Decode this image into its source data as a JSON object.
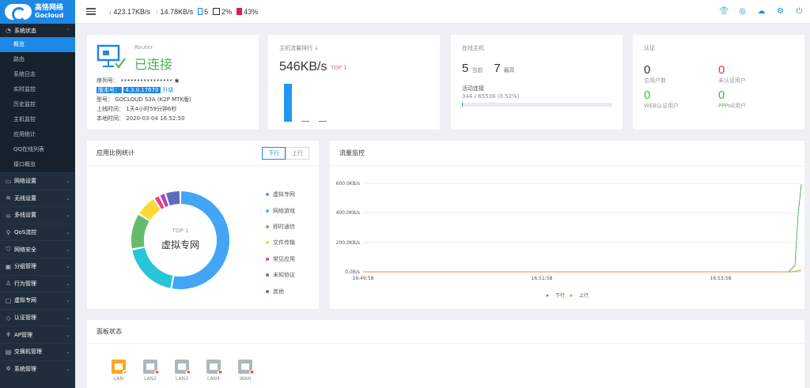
{
  "brand": {
    "name_cn": "高恪网络",
    "name_en": "Gocloud"
  },
  "topbar": {
    "down_speed": "423.17KB/s",
    "up_speed": "14.78KB/s",
    "mem": "5",
    "cpu": "2%",
    "disk": "43%",
    "icons": [
      "shirt-icon",
      "globe-icon",
      "cloud-upload-icon",
      "gear-icon",
      "power-icon"
    ]
  },
  "sidebar": {
    "status_group": "系统状态",
    "status_items": [
      "概览",
      "路由",
      "系统日志",
      "实时监控",
      "历史监控",
      "主机监控",
      "应用统计",
      "QQ在线列表",
      "接口概览"
    ],
    "groups": [
      {
        "label": "网络设置",
        "icon": "monitor-icon"
      },
      {
        "label": "无线设置",
        "icon": "wifi-icon"
      },
      {
        "label": "多线设置",
        "icon": "sliders-icon"
      },
      {
        "label": "QoS流控",
        "icon": "pin-icon"
      },
      {
        "label": "网络安全",
        "icon": "shield-icon"
      },
      {
        "label": "分组管理",
        "icon": "folder-icon"
      },
      {
        "label": "行为管理",
        "icon": "user-icon"
      },
      {
        "label": "虚拟专网",
        "icon": "lock-icon"
      },
      {
        "label": "认证管理",
        "icon": "badge-icon"
      },
      {
        "label": "AP管理",
        "icon": "antenna-icon"
      },
      {
        "label": "交换机管理",
        "icon": "switch-icon"
      },
      {
        "label": "系统管理",
        "icon": "cog-icon"
      }
    ]
  },
  "router_card": {
    "label": "Router",
    "status": "已连接",
    "serial_label": "序列号：",
    "serial_value": "••••••••••••••••",
    "version_label": "版本号：",
    "version_value": "4.3.0.17670",
    "upgrade": "升级",
    "model_label": "型号：",
    "model_value": "GOCLOUD S3A (K2P MTK版)",
    "uptime_label": "上线时间：",
    "uptime_value": "1天4小时59分钟6秒",
    "localtime_label": "本地时间：",
    "localtime_value": "2020-03-04 16:52:50"
  },
  "traffic_rank": {
    "title": "主机流量排行 ↓",
    "speed": "546KB/s",
    "top": "TOP 1",
    "bars": [
      1.0,
      0.03,
      0.02
    ]
  },
  "online_hosts": {
    "title": "在线主机",
    "current": "5",
    "current_label": "当前",
    "peak": "7",
    "peak_label": "最高",
    "conn_label": "活动连接",
    "conn_value": "344 / 65536 (0.52%)",
    "conn_fraction": 0.0052
  },
  "auth": {
    "title": "认证",
    "total_users": "0",
    "total_users_label": "总用户数",
    "unauth_users": "0",
    "unauth_users_label": "未认证用户",
    "web_users": "0",
    "web_users_label": "WEB认证用户",
    "pppoe_users": "0",
    "pppoe_users_label": "PPPoE用户"
  },
  "app_stats": {
    "title": "应用比例统计",
    "tab_down": "下行",
    "tab_up": "上行",
    "center_top": "TOP 1",
    "center_label": "虚拟专网",
    "slices": [
      {
        "label": "虚拟专网",
        "value": 53,
        "color": "#42a5f5"
      },
      {
        "label": "网络游戏",
        "value": 19,
        "color": "#26c6da"
      },
      {
        "label": "即时通信",
        "value": 12,
        "color": "#66bb6a"
      },
      {
        "label": "文件传输",
        "value": 7,
        "color": "#fdd835"
      },
      {
        "label": "常见应用",
        "value": 2,
        "color": "#ec407a"
      },
      {
        "label": "未知协议",
        "value": 2,
        "color": "#ab47bc"
      },
      {
        "label": "其他",
        "value": 5,
        "color": "#5c6bc0"
      }
    ]
  },
  "traffic_monitor": {
    "title": "流量监控",
    "y_ticks": [
      "600.0KB/s",
      "400.0KB/s",
      "200.0KB/s",
      "0.0B/s"
    ],
    "x_ticks": [
      "16:49:58",
      "16:51:58",
      "16:53:58"
    ],
    "legend_down": "下行",
    "legend_up": "上行",
    "color_down": "#4caf50",
    "color_up": "#f0883a"
  },
  "panel": {
    "title": "面板状态",
    "ports": [
      {
        "label": "LAN",
        "active": true
      },
      {
        "label": "LAN2",
        "active": false
      },
      {
        "label": "LAN3",
        "active": false
      },
      {
        "label": "LAN4",
        "active": false
      },
      {
        "label": "WAN",
        "active": false
      }
    ]
  }
}
